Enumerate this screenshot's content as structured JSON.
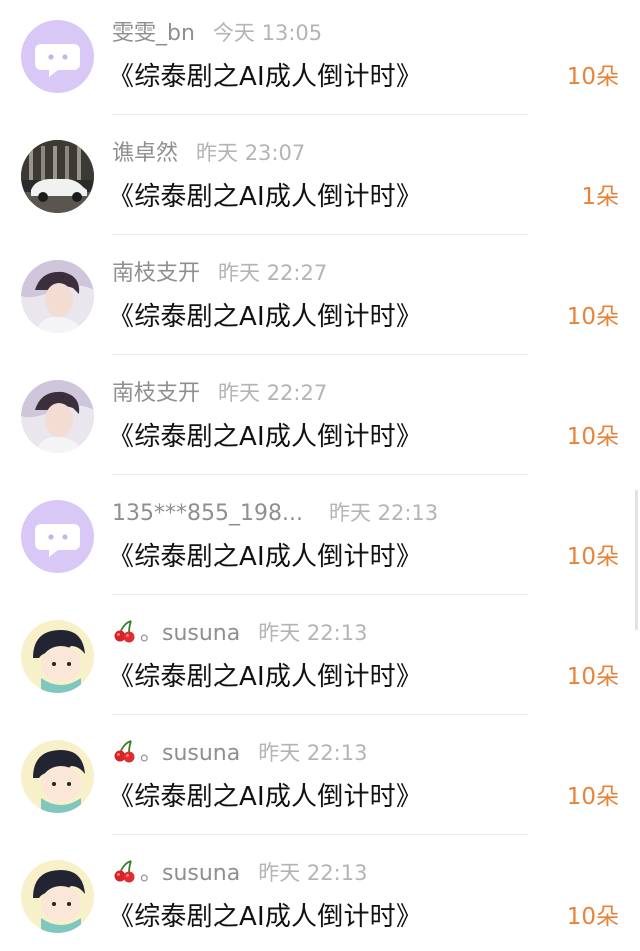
{
  "comments": [
    {
      "avatar": "chat-bubble-avatar",
      "username": "雯雯_bn",
      "time": "今天 13:05",
      "title": "《综泰剧之AI成人倒计时》",
      "gift": "10朵"
    },
    {
      "avatar": "car-photo-avatar",
      "username": "谯卓然",
      "time": "昨天 23:07",
      "title": "《综泰剧之AI成人倒计时》",
      "gift": "1朵"
    },
    {
      "avatar": "person-photo-avatar",
      "username": "南枝支开",
      "time": "昨天 22:27",
      "title": "《综泰剧之AI成人倒计时》",
      "gift": "10朵"
    },
    {
      "avatar": "person-photo-avatar",
      "username": "南枝支开",
      "time": "昨天 22:27",
      "title": "《综泰剧之AI成人倒计时》",
      "gift": "10朵"
    },
    {
      "avatar": "chat-bubble-avatar",
      "username": "135***855_198...",
      "time": "昨天 22:13",
      "title": "《综泰剧之AI成人倒计时》",
      "gift": "10朵"
    },
    {
      "avatar": "cartoon-boy-avatar",
      "username_prefix_icon": "cherry-icon",
      "username": "。susuna",
      "time": "昨天 22:13",
      "title": "《综泰剧之AI成人倒计时》",
      "gift": "10朵"
    },
    {
      "avatar": "cartoon-boy-avatar",
      "username_prefix_icon": "cherry-icon",
      "username": "。susuna",
      "time": "昨天 22:13",
      "title": "《综泰剧之AI成人倒计时》",
      "gift": "10朵"
    },
    {
      "avatar": "cartoon-boy-avatar",
      "username_prefix_icon": "cherry-icon",
      "username": "。susuna",
      "time": "昨天 22:13",
      "title": "《综泰剧之AI成人倒计时》",
      "gift": "10朵"
    }
  ],
  "colors": {
    "username": "#8f8f8f",
    "time": "#b4b4b4",
    "title": "#111111",
    "gift": "#e8833a",
    "chat_avatar_bg": "#d9c8f5"
  }
}
